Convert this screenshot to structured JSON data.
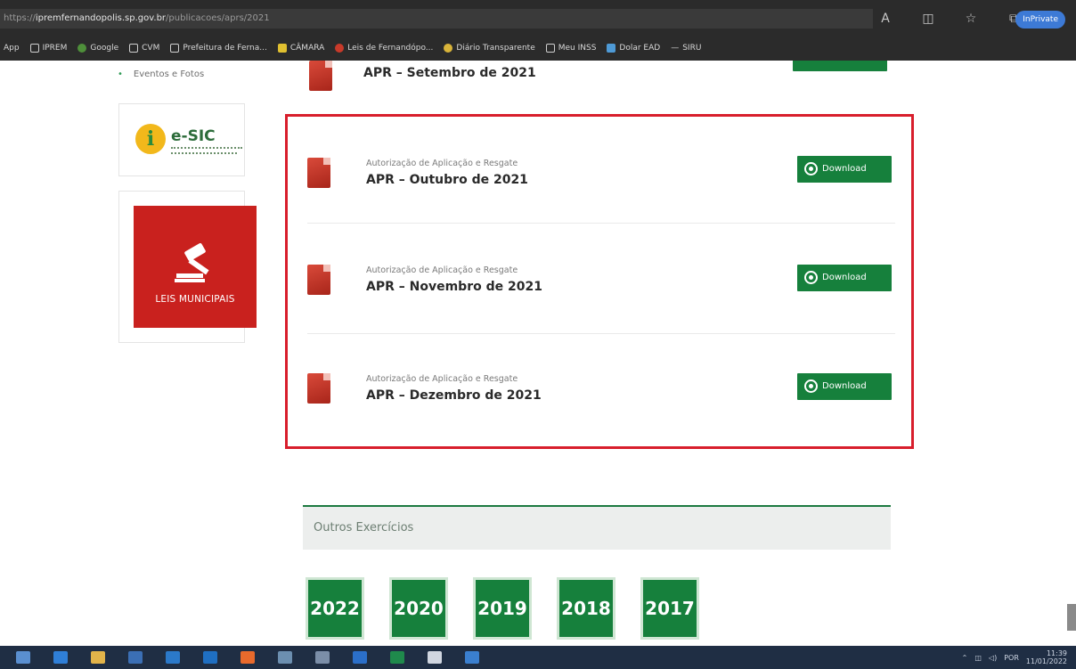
{
  "browser": {
    "url_scheme": "https://",
    "url_host": "ipremfernandopolis.sp.gov.br",
    "url_path": "/publicacoes/aprs/2021",
    "inprivate_label": "InPrivate",
    "bookmarks": [
      {
        "label": "App",
        "icon": "apps-icon"
      },
      {
        "label": "IPREM",
        "icon": "page-icon"
      },
      {
        "label": "Google",
        "icon": "google-icon"
      },
      {
        "label": "CVM",
        "icon": "page-icon"
      },
      {
        "label": "Prefeitura de Ferna...",
        "icon": "page-icon"
      },
      {
        "label": "CÂMARA",
        "icon": "folder-icon"
      },
      {
        "label": "Leis de Fernandópo...",
        "icon": "globe-icon"
      },
      {
        "label": "Diário Transparente",
        "icon": "shield-icon"
      },
      {
        "label": "Meu INSS",
        "icon": "page-icon"
      },
      {
        "label": "Dolar EAD",
        "icon": "chart-icon"
      },
      {
        "label": "SIRU",
        "icon": "dash-icon"
      }
    ]
  },
  "sidebar": {
    "link_label": "Eventos e Fotos",
    "esic": {
      "letter": "i",
      "title": "e-SIC"
    },
    "leis_label": "LEIS MUNICIPAIS"
  },
  "top_item": {
    "title": "APR – Setembro de 2021"
  },
  "apr_items": [
    {
      "subtitle": "Autorização de Aplicação e Resgate",
      "title": "APR – Outubro de 2021",
      "button_label": "Download"
    },
    {
      "subtitle": "Autorização de Aplicação e Resgate",
      "title": "APR – Novembro de 2021",
      "button_label": "Download"
    },
    {
      "subtitle": "Autorização de Aplicação e Resgate",
      "title": "APR – Dezembro de 2021",
      "button_label": "Download"
    }
  ],
  "outros": {
    "title": "Outros Exercícios",
    "years": [
      "2022",
      "2020",
      "2019",
      "2018",
      "2017"
    ]
  },
  "taskbar": {
    "lang": "POR",
    "time": "11:39",
    "date": "11/01/2022"
  },
  "colors": {
    "accent_green": "#16803c",
    "highlight_red": "#d81e2c",
    "leis_red": "#c9211e"
  }
}
